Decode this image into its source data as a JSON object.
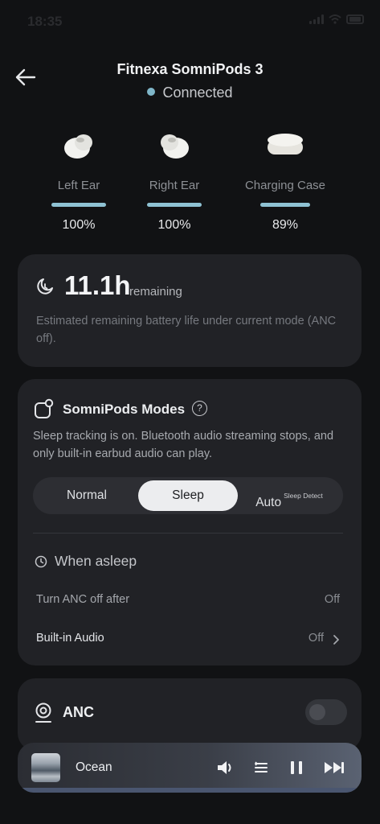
{
  "status_bar": {
    "time": "18:35"
  },
  "header": {
    "title": "Fitnexa SomniPods 3",
    "status": "Connected"
  },
  "devices": [
    {
      "label": "Left Ear",
      "battery": "100%",
      "level": 1.0
    },
    {
      "label": "Right Ear",
      "battery": "100%",
      "level": 1.0
    },
    {
      "label": "Charging Case",
      "battery": "89%",
      "level": 0.89
    }
  ],
  "battery_card": {
    "hours": "11.1h",
    "remaining_label": "remaining",
    "description": "Estimated remaining battery life under current mode (ANC off)."
  },
  "modes_card": {
    "title": "SomniPods Modes",
    "help_glyph": "?",
    "description": "Sleep tracking is on. Bluetooth audio streaming stops, and only built-in earbud audio can play.",
    "options": [
      "Normal",
      "Sleep",
      "Auto"
    ],
    "auto_superscript": "Sleep Detect",
    "selected": "Sleep",
    "when_asleep_title": "When asleep",
    "rows": [
      {
        "label": "Turn ANC off after",
        "value": "Off"
      },
      {
        "label": "Built-in Audio",
        "value": "Off"
      }
    ]
  },
  "anc_card": {
    "title": "ANC",
    "toggle_on": false
  },
  "player": {
    "track": "Ocean"
  },
  "colors": {
    "accent": "#8fc2d3",
    "connected_dot": "#7fb6c9",
    "card_bg": "#212226",
    "page_bg": "#111214"
  }
}
